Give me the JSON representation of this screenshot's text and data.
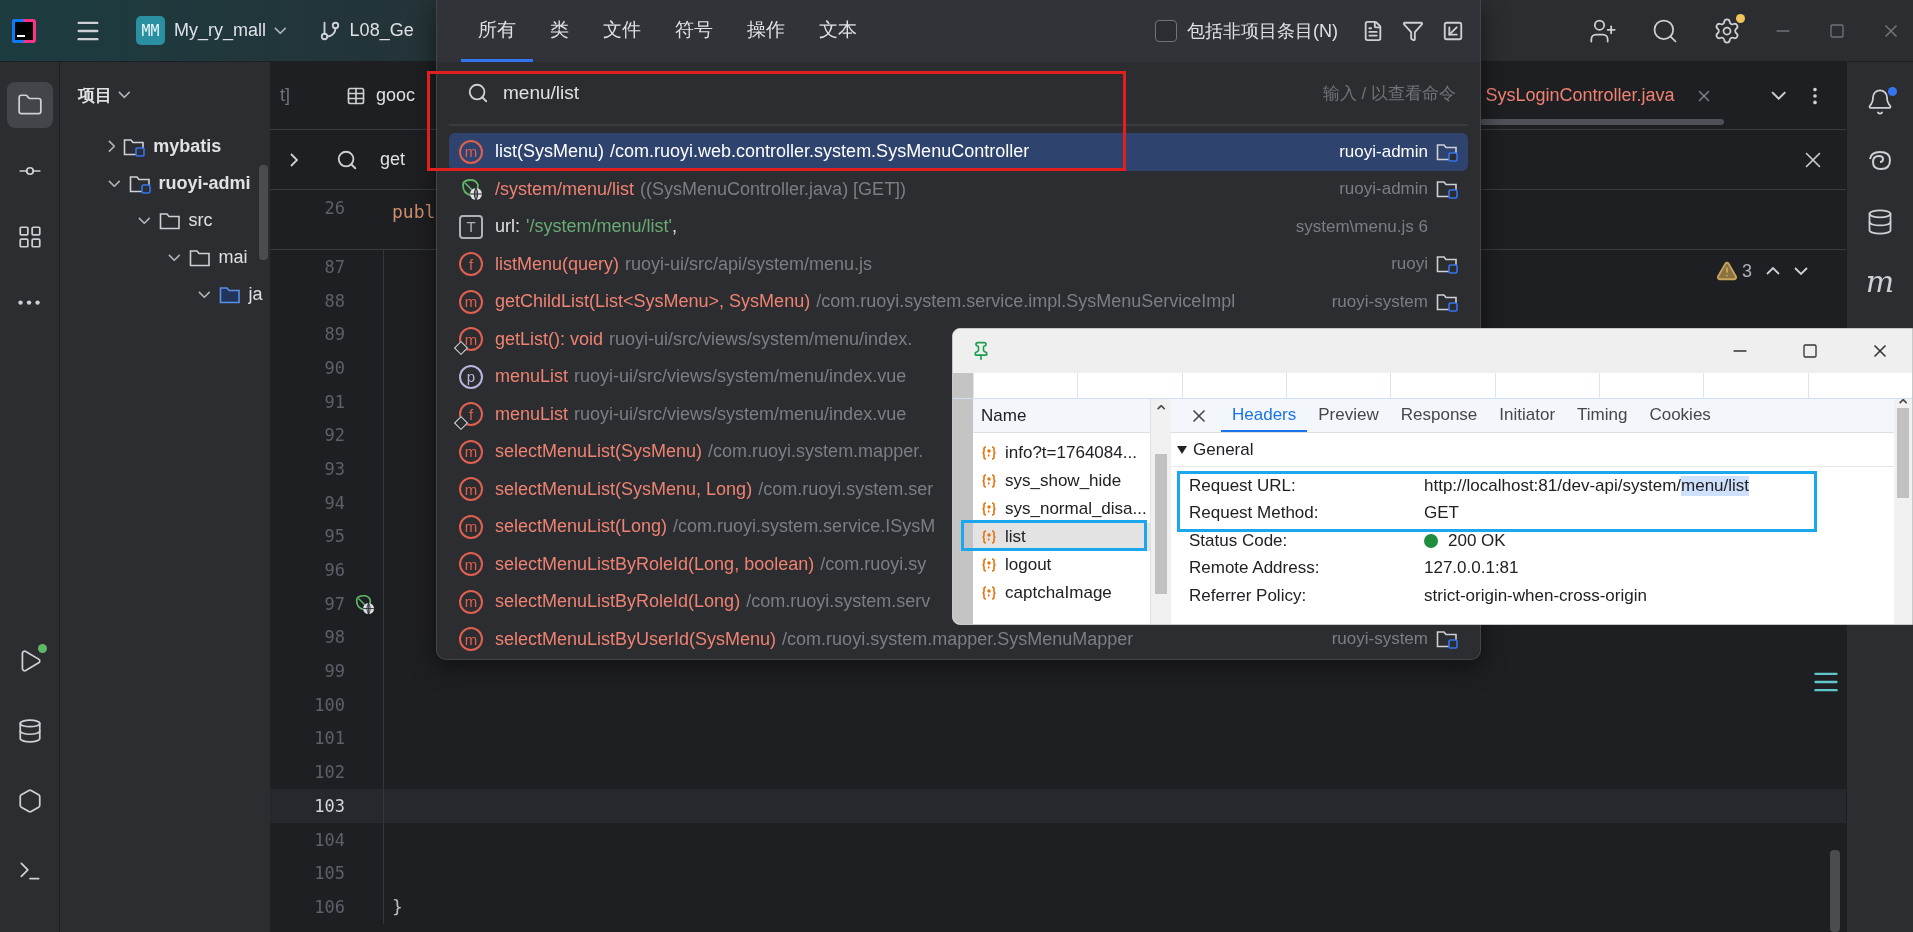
{
  "title_bar": {
    "badge": "MM",
    "project": "My_ry_mall",
    "branch": "L08_Ge",
    "settings_dot": true
  },
  "tool_strip": {
    "top": [
      {
        "kind": "project",
        "selected": true
      },
      {
        "kind": "commit",
        "selected": false
      },
      {
        "kind": "structure",
        "selected": false
      },
      {
        "kind": "more",
        "selected": false
      }
    ],
    "bottom": [
      {
        "kind": "run",
        "dot": true
      },
      {
        "kind": "database",
        "dot": false
      },
      {
        "kind": "services",
        "dot": false
      },
      {
        "kind": "terminal",
        "dot": false
      }
    ]
  },
  "project_panel": {
    "title": "项目",
    "tree": [
      {
        "label": "mybatis",
        "kind": "module",
        "expanded": false
      },
      {
        "label": "ruoyi-admi",
        "kind": "module",
        "expanded": true,
        "children": [
          {
            "label": "src",
            "kind": "plain",
            "expanded": true,
            "children": [
              {
                "label": "mai",
                "kind": "plain",
                "expanded": true,
                "children": [
                  {
                    "label": "ja",
                    "kind": "source",
                    "expanded": true
                  }
                ]
              }
            ]
          }
        ]
      }
    ]
  },
  "editor": {
    "tabs": [
      {
        "label": "t]",
        "kind": "text",
        "closable": false
      },
      {
        "label": "gooc",
        "kind": "table",
        "closable": false
      },
      {
        "label": "SysLoginController.java",
        "kind": "java",
        "closable": true
      }
    ],
    "find": {
      "value": "get"
    },
    "sticky": {
      "number": "26",
      "code": "publ"
    },
    "warnings": "3",
    "lines": [
      {
        "number": "87",
        "current": false,
        "endpoint": false
      },
      {
        "number": "88",
        "current": false,
        "endpoint": false
      },
      {
        "number": "89",
        "current": false,
        "endpoint": false
      },
      {
        "number": "90",
        "current": false,
        "endpoint": false
      },
      {
        "number": "91",
        "current": false,
        "endpoint": false
      },
      {
        "number": "92",
        "current": false,
        "endpoint": false
      },
      {
        "number": "93",
        "current": false,
        "endpoint": false
      },
      {
        "number": "94",
        "current": false,
        "endpoint": false
      },
      {
        "number": "95",
        "current": false,
        "endpoint": false
      },
      {
        "number": "96",
        "current": false,
        "endpoint": false
      },
      {
        "number": "97",
        "current": false,
        "endpoint": true
      },
      {
        "number": "98",
        "current": false,
        "endpoint": false
      },
      {
        "number": "99",
        "current": false,
        "endpoint": false
      },
      {
        "number": "100",
        "current": false,
        "endpoint": false
      },
      {
        "number": "101",
        "current": false,
        "endpoint": false
      },
      {
        "number": "102",
        "current": false,
        "endpoint": false
      },
      {
        "number": "103",
        "current": true,
        "endpoint": false
      },
      {
        "number": "104",
        "current": false,
        "endpoint": false
      },
      {
        "number": "105",
        "current": false,
        "endpoint": false
      },
      {
        "number": "106",
        "current": false,
        "endpoint": false,
        "code": "}"
      }
    ]
  },
  "right_strip": [
    {
      "kind": "notifications",
      "dot": true
    },
    {
      "kind": "ai",
      "dot": false
    },
    {
      "kind": "database",
      "dot": false
    },
    {
      "kind": "maven",
      "dot": false,
      "label": "m"
    }
  ],
  "search_popup": {
    "tabs": [
      {
        "label": "所有",
        "selected": true
      },
      {
        "label": "类",
        "selected": false
      },
      {
        "label": "文件",
        "selected": false
      },
      {
        "label": "符号",
        "selected": false
      },
      {
        "label": "操作",
        "selected": false
      },
      {
        "label": "文本",
        "selected": false
      }
    ],
    "include_non_project": {
      "label": "包括非项目条目(N)",
      "checked": false
    },
    "search": {
      "value": "menu/list",
      "hint": "输入 / 以查看命令"
    },
    "results": [
      {
        "kind": "method",
        "badge": "m",
        "mark": false,
        "selected": true,
        "name": "list(SysMenu)",
        "detail": "/com.ruoyi.web.controller.system.SysMenuController",
        "location": "ruoyi-admin",
        "folder": true
      },
      {
        "kind": "endpoint",
        "mark": false,
        "selected": false,
        "name": "/system/menu/list",
        "detail": "((SysMenuController.java) [GET])",
        "location": "ruoyi-admin",
        "folder": true
      },
      {
        "kind": "text",
        "badge": "T",
        "mark": false,
        "selected": false,
        "name": "url:",
        "value": "'/system/menu/list'",
        "tail": ",",
        "location": "system\\menu.js 6",
        "folder": false
      },
      {
        "kind": "function",
        "badge": "f",
        "mark": false,
        "selected": false,
        "name": "listMenu(query)",
        "detail": "ruoyi-ui/src/api/system/menu.js",
        "location": "ruoyi",
        "folder": true
      },
      {
        "kind": "method",
        "badge": "m",
        "mark": false,
        "selected": false,
        "name": "getChildList(List<SysMenu>, SysMenu)",
        "detail": "/com.ruoyi.system.service.impl.SysMenuServiceImpl",
        "location": "ruoyi-system",
        "folder": true
      },
      {
        "kind": "method",
        "badge": "m",
        "mark": true,
        "selected": false,
        "name": "getList(): void",
        "detail": "ruoyi-ui/src/views/system/menu/index."
      },
      {
        "kind": "property",
        "badge": "p",
        "mark": false,
        "selected": false,
        "name": "menuList",
        "detail": "ruoyi-ui/src/views/system/menu/index.vue"
      },
      {
        "kind": "function",
        "badge": "f",
        "mark": true,
        "selected": false,
        "name": "menuList",
        "detail": "ruoyi-ui/src/views/system/menu/index.vue"
      },
      {
        "kind": "method",
        "badge": "m",
        "mark": false,
        "selected": false,
        "name": "selectMenuList(SysMenu)",
        "detail": "/com.ruoyi.system.mapper."
      },
      {
        "kind": "method",
        "badge": "m",
        "mark": false,
        "selected": false,
        "name": "selectMenuList(SysMenu, Long)",
        "detail": "/com.ruoyi.system.ser"
      },
      {
        "kind": "method",
        "badge": "m",
        "mark": false,
        "selected": false,
        "name": "selectMenuList(Long)",
        "detail": "/com.ruoyi.system.service.ISysM"
      },
      {
        "kind": "method",
        "badge": "m",
        "mark": false,
        "selected": false,
        "name": "selectMenuListByRoleId(Long, boolean)",
        "detail": "/com.ruoyi.sy"
      },
      {
        "kind": "method",
        "badge": "m",
        "mark": false,
        "selected": false,
        "name": "selectMenuListByRoleId(Long)",
        "detail": "/com.ruoyi.system.serv"
      },
      {
        "kind": "method",
        "badge": "m",
        "mark": false,
        "selected": false,
        "name": "selectMenuListByUserId(SysMenu)",
        "detail": "/com.ruoyi.system.mapper.SysMenuMapper",
        "location": "ruoyi-system",
        "folder": true
      }
    ]
  },
  "devtools": {
    "requests": {
      "header": "Name",
      "items": [
        {
          "label": "info?t=1764084...",
          "selected": false
        },
        {
          "label": "sys_show_hide",
          "selected": false
        },
        {
          "label": "sys_normal_disa...",
          "selected": false
        },
        {
          "label": "list",
          "selected": true
        },
        {
          "label": "logout",
          "selected": false
        },
        {
          "label": "captchaImage",
          "selected": false
        }
      ]
    },
    "tabs": [
      {
        "label": "Headers",
        "selected": true
      },
      {
        "label": "Preview",
        "selected": false
      },
      {
        "label": "Response",
        "selected": false
      },
      {
        "label": "Initiator",
        "selected": false
      },
      {
        "label": "Timing",
        "selected": false
      },
      {
        "label": "Cookies",
        "selected": false
      }
    ],
    "section": {
      "title": "General",
      "expanded": true
    },
    "fields": [
      {
        "key": "Request URL:",
        "value": "http://localhost:81/dev-api/system/",
        "highlight": "menu/list"
      },
      {
        "key": "Request Method:",
        "value": "GET"
      },
      {
        "key": "Status Code:",
        "value": "200 OK",
        "color": "#1e8e3e"
      },
      {
        "key": "Remote Address:",
        "value": "127.0.0.1:81"
      },
      {
        "key": "Referrer Policy:",
        "value": "strict-origin-when-cross-origin"
      }
    ]
  }
}
